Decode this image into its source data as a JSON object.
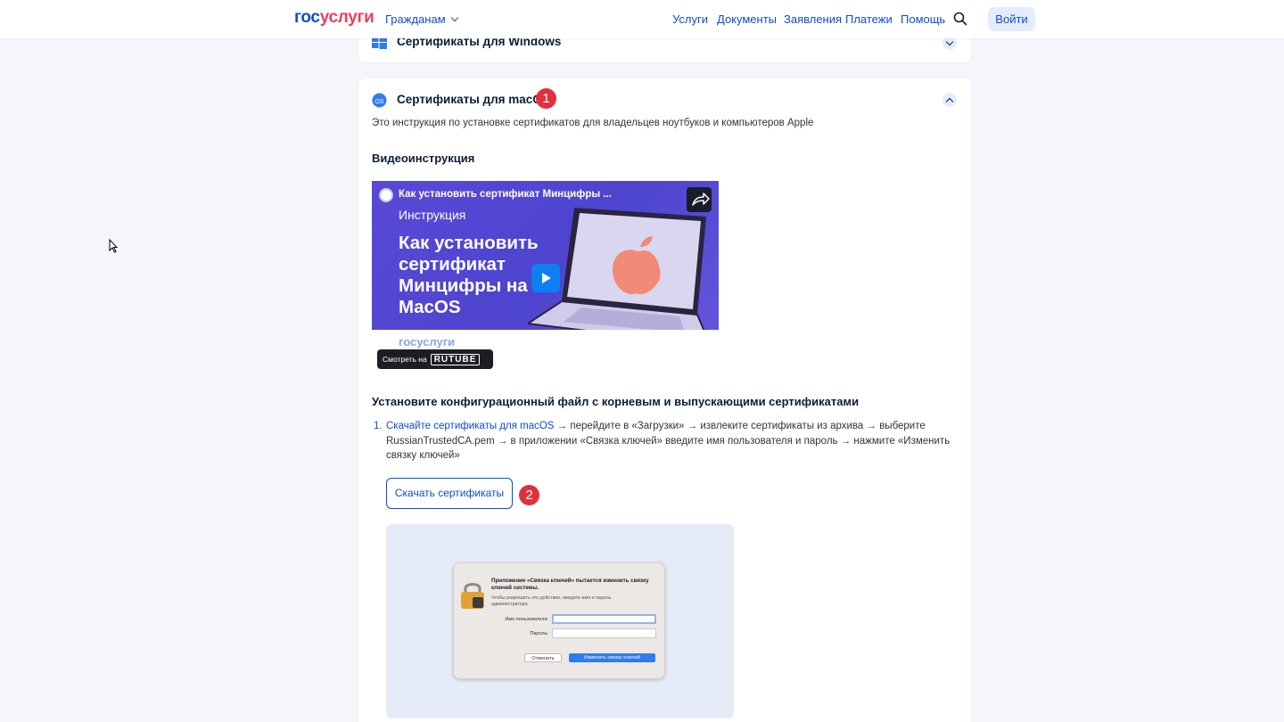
{
  "header": {
    "logo_part1": "гос",
    "logo_part2": "услуги",
    "audience_label": "Гражданам",
    "nav": [
      {
        "label": "Услуги"
      },
      {
        "label": "Документы"
      },
      {
        "label": "Заявления"
      },
      {
        "label": "Платежи"
      },
      {
        "label": "Помощь"
      }
    ],
    "search_icon": "search-icon",
    "login_label": "Войти"
  },
  "sections": {
    "windows": {
      "title": "Сертификаты для Windows",
      "icon": "windows-icon",
      "state": "collapsed"
    },
    "macos": {
      "title": "Сертификаты для macOS",
      "icon_label": "OS",
      "state": "expanded",
      "marker": "1",
      "intro": "Это инструкция по установке сертификатов для владельцев ноутбуков и компьютеров Apple",
      "video_heading": "Видеоинструкция",
      "video": {
        "title": "Как установить сертификат Минцифры ...",
        "subtitle": "Инструкция",
        "headline": "Как установить сертификат Минцифры на MacOS",
        "brand": "госуслуги",
        "watch_on": "Смотреть на",
        "platform": "RUTUBE"
      },
      "install_heading": "Установите конфигурационный файл с корневым и выпускающими сертификатами",
      "step": {
        "number": "1.",
        "link_text": "Скачайте сертификаты для macOS",
        "text": " → перейдите в «Загрузки» → извлеките сертификаты из архива → выберите RussianTrustedCA.pem → в приложении «Связка ключей» введите имя пользователя и пароль → нажмите «Изменить связку ключей»"
      },
      "download_button": "Скачать сертификаты",
      "marker2": "2",
      "dialog": {
        "title": "Приложение «Связка ключей» пытается изменить связку ключей системы.",
        "description": "Чтобы разрешить это действие, введите имя и пароль администратора.",
        "username_label": "Имя пользователя:",
        "password_label": "Пароль:",
        "cancel": "Отменить",
        "confirm": "Изменить связку ключей"
      }
    }
  },
  "colors": {
    "accent": "#0d4cd3",
    "brand_red": "#ee3f58",
    "marker": "#e0303e",
    "page_bg": "#f4f6fb"
  }
}
